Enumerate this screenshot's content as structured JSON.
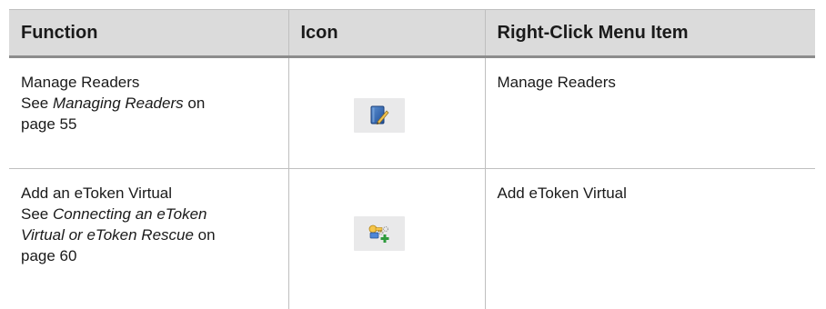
{
  "table": {
    "headers": {
      "function": "Function",
      "icon": "Icon",
      "menu_item": "Right-Click Menu Item"
    },
    "rows": [
      {
        "function_title": "Manage Readers",
        "see_prefix": "See ",
        "see_ref_line1": "Managing Readers",
        "see_suffix_line1": " on",
        "page_ref": "page 55",
        "icon_name": "manage-readers-icon",
        "menu_item": "Manage Readers"
      },
      {
        "function_title": "Add an eToken Virtual",
        "see_prefix": "See ",
        "see_ref_line1": "Connecting an eToken",
        "see_ref_line2": "Virtual or eToken Rescue",
        "see_suffix_line2": " on",
        "page_ref": "page 60",
        "icon_name": "add-etoken-virtual-icon",
        "menu_item": "Add eToken Virtual"
      }
    ]
  },
  "colors": {
    "header_bg": "#dbdbdb",
    "icon_bg": "#e9e9ea",
    "grid_line": "#bfbfbf",
    "header_rule": "#8c8c8c"
  }
}
